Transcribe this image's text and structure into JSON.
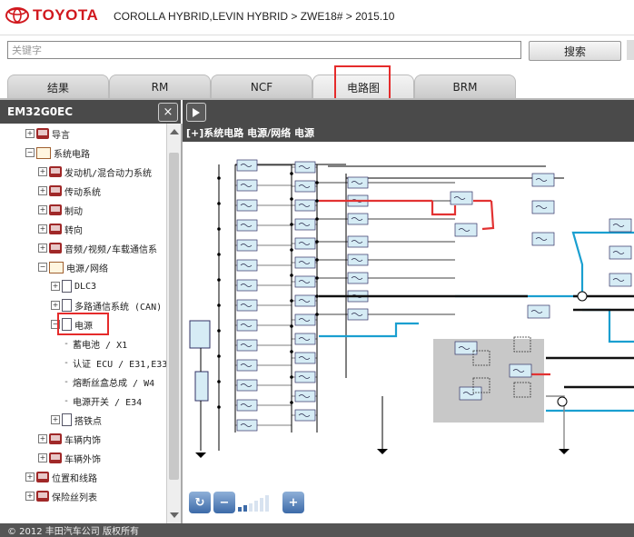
{
  "header": {
    "brand": "TOYOTA",
    "breadcrumb": "COROLLA HYBRID,LEVIN HYBRID > ZWE18# > 2015.10"
  },
  "search": {
    "placeholder": "关键字",
    "button_label": "搜索"
  },
  "tabs": [
    {
      "label": "结果",
      "active": false
    },
    {
      "label": "RM",
      "active": false
    },
    {
      "label": "NCF",
      "active": false
    },
    {
      "label": "电路图",
      "active": true
    },
    {
      "label": "BRM",
      "active": false
    }
  ],
  "left_panel": {
    "title": "EM32G0EC",
    "close_icon": "×"
  },
  "tree": [
    {
      "label": "导言",
      "icon": "book-icon",
      "expander": "+"
    },
    {
      "label": "系统电路",
      "icon": "open-book-icon",
      "expander": "−"
    },
    {
      "label": "发动机/混合动力系统",
      "icon": "book-icon",
      "expander": "+"
    },
    {
      "label": "传动系统",
      "icon": "book-icon",
      "expander": "+"
    },
    {
      "label": "制动",
      "icon": "book-icon",
      "expander": "+"
    },
    {
      "label": "转向",
      "icon": "book-icon",
      "expander": "+"
    },
    {
      "label": "音频/视频/车载通信系",
      "icon": "book-icon",
      "expander": "+"
    },
    {
      "label": "电源/网络",
      "icon": "open-book-icon",
      "expander": "−"
    },
    {
      "label": "DLC3",
      "icon": "document-icon",
      "expander": "+"
    },
    {
      "label": "多路通信系统 (CAN)",
      "icon": "document-icon",
      "expander": "+"
    },
    {
      "label": "电源",
      "icon": "document-icon",
      "expander": "−"
    },
    {
      "label": "蓄电池 / X1",
      "icon": "leaf",
      "expander": ""
    },
    {
      "label": "认证 ECU / E31,E33",
      "icon": "leaf",
      "expander": ""
    },
    {
      "label": "熔断丝盒总成 / W4",
      "icon": "leaf",
      "expander": ""
    },
    {
      "label": "电源开关 / E34",
      "icon": "leaf",
      "expander": ""
    },
    {
      "label": "搭铁点",
      "icon": "document-icon",
      "expander": "+"
    },
    {
      "label": "车辆内饰",
      "icon": "book-icon",
      "expander": "+"
    },
    {
      "label": "车辆外饰",
      "icon": "book-icon",
      "expander": "+"
    },
    {
      "label": "位置和线路",
      "icon": "book-icon",
      "expander": "+"
    },
    {
      "label": "保险丝列表",
      "icon": "book-icon",
      "expander": "+"
    }
  ],
  "diagram": {
    "title": "[+]系统电路  电源/网络  电源",
    "colors": {
      "wire_red": "#e23232",
      "wire_blue": "#1a9fd0",
      "wire_black": "#111111",
      "component": "#d6ecf5",
      "shade": "#c8c8c8"
    }
  },
  "toolbar": {
    "icons": [
      "refresh-icon",
      "zoom-out-icon",
      "zoom-in-icon"
    ],
    "zoom_level_of": 6,
    "zoom_level": 2
  },
  "footer": {
    "text": "© 2012 丰田汽车公司  版权所有"
  }
}
